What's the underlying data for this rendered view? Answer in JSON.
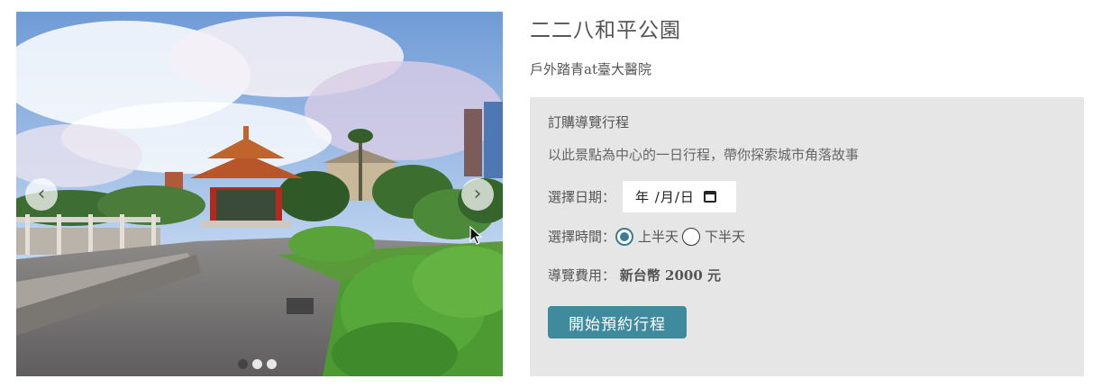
{
  "carousel": {
    "prev_icon": "chevron-left-icon",
    "next_icon": "chevron-right-icon",
    "slide_count": 3,
    "active_slide": 1
  },
  "place": {
    "title": "二二八和平公園",
    "subtitle": "戶外踏青at臺大醫院"
  },
  "booking": {
    "heading": "訂購導覽行程",
    "description": "以此景點為中心的一日行程，帶你探索城市角落故事",
    "date_label": "選擇日期：",
    "date_placeholder": "年 /月/日",
    "time_label": "選擇時間：",
    "time_options": [
      "上半天",
      "下半天"
    ],
    "time_selected": "上半天",
    "fee_label": "導覽費用：",
    "fee_value": "新台幣 2000 元",
    "submit_label": "開始預約行程"
  },
  "colors": {
    "accent": "#3f8a9c",
    "panel_bg": "#e6e6e6"
  }
}
